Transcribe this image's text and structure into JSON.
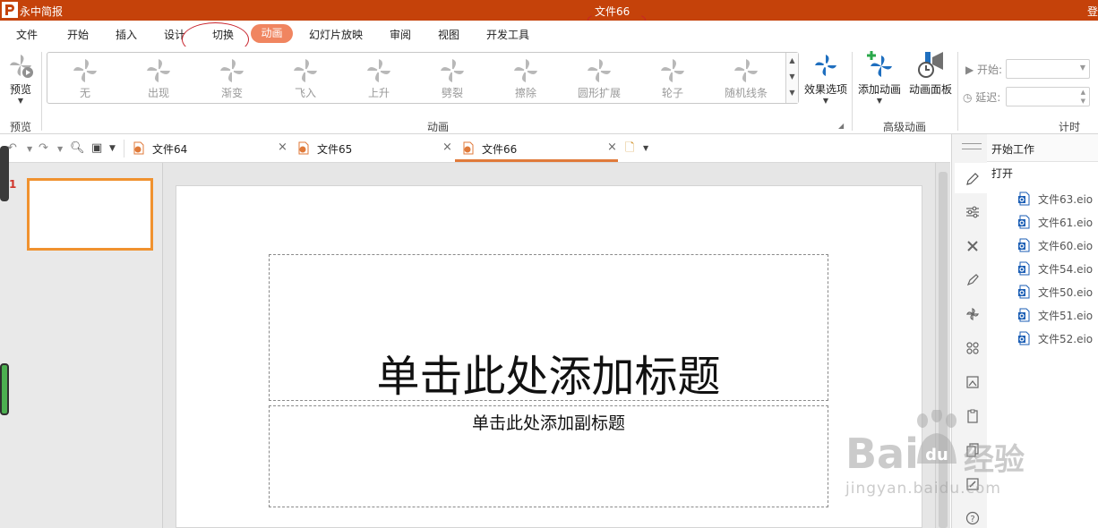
{
  "titlebar": {
    "app_name": "永中简报",
    "document_title": "文件66",
    "login_text": "登"
  },
  "menu": {
    "items": [
      "文件",
      "开始",
      "插入",
      "设计",
      "切换",
      "动画",
      "幻灯片放映",
      "审阅",
      "视图",
      "开发工具"
    ],
    "active": "动画"
  },
  "ribbon": {
    "preview": {
      "label": "预览",
      "group_label": "预览"
    },
    "effects": [
      {
        "label": "无",
        "icon": "pinwheel-icon"
      },
      {
        "label": "出现",
        "icon": "starburst-icon"
      },
      {
        "label": "渐变",
        "icon": "pinwheel-icon"
      },
      {
        "label": "飞入",
        "icon": "fly-in-icon"
      },
      {
        "label": "上升",
        "icon": "pinwheel-icon"
      },
      {
        "label": "劈裂",
        "icon": "split-icon"
      },
      {
        "label": "擦除",
        "icon": "pinwheel-icon"
      },
      {
        "label": "圆形扩展",
        "icon": "pinwheel-icon"
      },
      {
        "label": "轮子",
        "icon": "wheel-icon"
      },
      {
        "label": "随机线条",
        "icon": "lines-icon"
      }
    ],
    "effect_options": {
      "label": "效果选项"
    },
    "animation_group_label": "动画",
    "add_animation": {
      "label": "添加动画"
    },
    "animation_pane": {
      "label": "动画面板"
    },
    "advanced_group_label": "高级动画",
    "timing": {
      "start_label": "开始:",
      "delay_label": "延迟:",
      "group_label": "计时"
    }
  },
  "tabs": [
    {
      "label": "文件64",
      "active": false
    },
    {
      "label": "文件65",
      "active": false
    },
    {
      "label": "文件66",
      "active": true
    }
  ],
  "slides_panel": {
    "slide_number": "1"
  },
  "slide": {
    "title_placeholder": "单击此处添加标题",
    "subtitle_placeholder": "单击此处添加副标题"
  },
  "task_pane": {
    "title": "开始工作",
    "open_label": "打开",
    "recent_files": [
      "文件63.eio",
      "文件61.eio",
      "文件60.eio",
      "文件54.eio",
      "文件50.eio",
      "文件51.eio",
      "文件52.eio"
    ]
  },
  "watermark": {
    "brand": "Bai",
    "brand_suffix": "经验",
    "url": "jingyan.baidu.com"
  },
  "colors": {
    "titlebar": "#c5420a",
    "active_tab": "#f08560",
    "slide_border": "#f0922f",
    "annotation": "#c8232c",
    "file_icon": "#1b5eb5"
  }
}
